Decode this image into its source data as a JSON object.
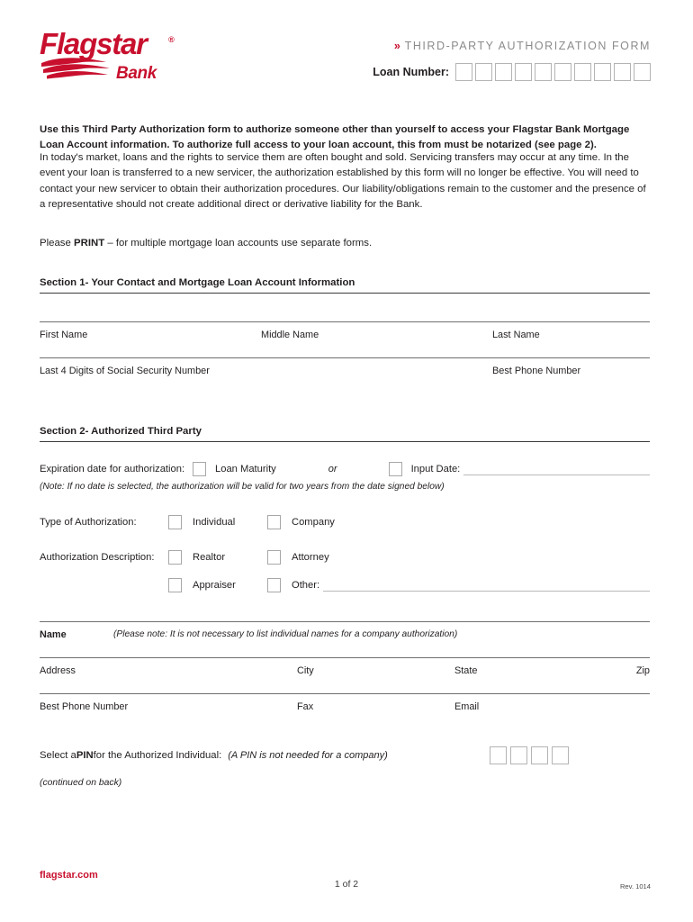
{
  "header": {
    "logo_name": "Flagstar",
    "logo_sub": "Bank",
    "logo_trademark": "®",
    "form_title": "THIRD-PARTY AUTHORIZATION FORM",
    "chevron": "»",
    "loan_number_label": "Loan Number:",
    "loan_number_boxes": 10
  },
  "intro": {
    "bold_paragraph": "Use this Third Party Authorization form to authorize someone other than yourself to access your Flagstar Bank Mortgage Loan Account information. To authorize full access to your loan account, this from must be notarized (see page 2).",
    "body_paragraph": "In today's market, loans and the rights to service them are often bought and sold.  Servicing transfers may occur at any time. In the event your loan is transferred to a new servicer, the authorization established by this form will no longer be effective.  You will need to contact your new servicer to obtain their authorization procedures. Our liability/obligations remain to the customer and the presence of a representative should not create additional direct or derivative liability for the Bank.",
    "print_prefix": "Please ",
    "print_bold": "PRINT",
    "print_suffix": " – for multiple mortgage loan accounts use separate forms."
  },
  "section1": {
    "heading": "Section 1- Your Contact and Mortgage Loan Account Information",
    "fields": {
      "first_name": "First Name",
      "middle_name": "Middle Name",
      "last_name": "Last Name",
      "ssn_last4": "Last 4 Digits of Social Security Number",
      "best_phone": "Best Phone Number"
    }
  },
  "section2": {
    "heading": "Section 2- Authorized Third Party",
    "expiration": {
      "label": "Expiration date for authorization:",
      "option_loan_maturity": "Loan Maturity",
      "separator": "or",
      "option_input_date": "Input Date:",
      "note": "(Note: If no date is selected, the authorization will be valid for two years from the date signed below)"
    },
    "type_of_authorization": {
      "label": "Type of Authorization:",
      "option_individual": "Individual",
      "option_company": "Company"
    },
    "authorization_description": {
      "label": "Authorization Description:",
      "option_realtor": "Realtor",
      "option_attorney": "Attorney",
      "option_appraiser": "Appraiser",
      "option_other": "Other:"
    },
    "name_row": {
      "label": "Name",
      "note": "(Please note: It is not necessary to list individual names for a company authorization)"
    },
    "address_fields": {
      "address": "Address",
      "city": "City",
      "state": "State",
      "zip": "Zip",
      "best_phone": "Best Phone  Number",
      "fax": "Fax",
      "email": "Email"
    },
    "pin": {
      "prefix": "Select a ",
      "bold": "PIN",
      "suffix": " for the Authorized Individual:",
      "note": "(A PIN is not needed for a company)",
      "boxes": 4
    },
    "continued": "(continued on back)"
  },
  "footer": {
    "website": "flagstar.com",
    "page": "1 of 2",
    "revision": "Rev. 1014"
  },
  "colors": {
    "brand_red": "#c8102e",
    "title_gray": "#8b8b8b",
    "text": "#231f20"
  }
}
